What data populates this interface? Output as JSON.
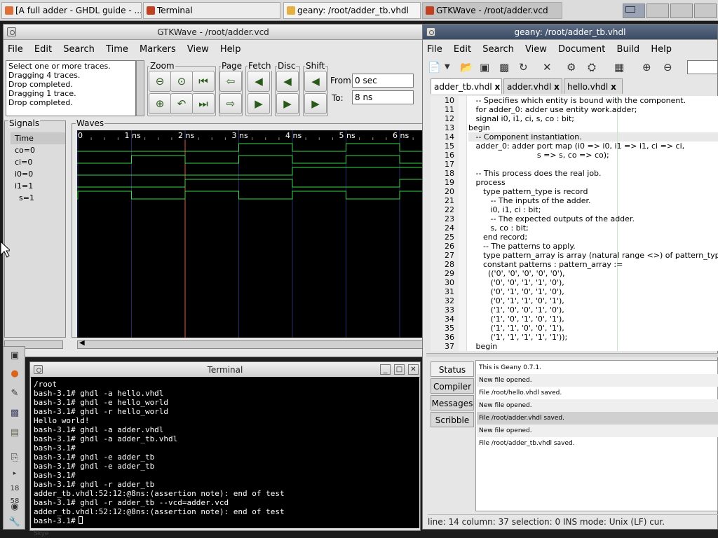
{
  "taskbar": {
    "items": [
      {
        "label": "[A full adder - GHDL guide - ..."
      },
      {
        "label": "Terminal"
      },
      {
        "label": "geany: /root/adder_tb.vhdl"
      },
      {
        "label": "GTKWave - /root/adder.vcd"
      }
    ]
  },
  "gtkwave": {
    "title": "GTKWave - /root/adder.vcd",
    "menu": [
      "File",
      "Edit",
      "Search",
      "Time",
      "Markers",
      "View",
      "Help"
    ],
    "messages": "Select one or more traces.\nDragging 4 traces.\nDrop completed.\nDragging 1 trace.\nDrop completed.",
    "groups": {
      "zoom": "Zoom",
      "page": "Page",
      "fetch": "Fetch",
      "disc": "Disc",
      "shift": "Shift"
    },
    "from_label": "From:",
    "from_value": "0 sec",
    "to_label": "To:",
    "to_value": "8 ns",
    "signals_label": "Signals",
    "waves_label": "Waves",
    "signal_header": "Time",
    "signals": [
      "co=0",
      "ci=0",
      "i0=0",
      "i1=1",
      "s=1"
    ],
    "time_ticks": [
      "0",
      "1 ns",
      "2 ns",
      "3 ns",
      "4 ns",
      "5 ns",
      "6 ns"
    ],
    "wave_color": "#39d84a",
    "marker_color": "#e05a3a",
    "waves_ns": {
      "co": [
        [
          3,
          4
        ],
        [
          5,
          6
        ]
      ],
      "ci": [
        [
          1,
          2
        ],
        [
          3,
          4
        ],
        [
          5,
          6
        ]
      ],
      "i0": [
        [
          4,
          8
        ]
      ],
      "i1": [
        [
          2,
          4
        ],
        [
          6,
          8
        ]
      ],
      "s": [
        [
          0,
          1
        ],
        [
          2,
          3
        ],
        [
          4,
          5
        ],
        [
          6,
          7
        ]
      ]
    },
    "marker_ns": 2
  },
  "geany": {
    "title": "geany: /root/adder_tb.vhdl",
    "menu": [
      "File",
      "Edit",
      "Search",
      "View",
      "Document",
      "Build",
      "Help"
    ],
    "tabs": [
      "adder_tb.vhdl",
      "adder.vhdl",
      "hello.vhdl"
    ],
    "tab_close": "x",
    "lines": [
      {
        "n": "10",
        "t": "   -- Specifies which entity is bound with the component."
      },
      {
        "n": "11",
        "t": "   for adder_0: adder use entity work.adder;"
      },
      {
        "n": "12",
        "t": "   signal i0, i1, ci, s, co : bit;"
      },
      {
        "n": "13",
        "t": "begin"
      },
      {
        "n": "14",
        "t": "   -- Component instantiation."
      },
      {
        "n": "15",
        "t": "   adder_0: adder port map (i0 => i0, i1 => i1, ci => ci,"
      },
      {
        "n": "16",
        "t": "                            s => s, co => co);"
      },
      {
        "n": "17",
        "t": ""
      },
      {
        "n": "18",
        "t": "   -- This process does the real job."
      },
      {
        "n": "19",
        "t": "   process"
      },
      {
        "n": "20",
        "t": "      type pattern_type is record"
      },
      {
        "n": "21",
        "t": "         -- The inputs of the adder."
      },
      {
        "n": "22",
        "t": "         i0, i1, ci : bit;"
      },
      {
        "n": "23",
        "t": "         -- The expected outputs of the adder."
      },
      {
        "n": "24",
        "t": "         s, co : bit;"
      },
      {
        "n": "25",
        "t": "      end record;"
      },
      {
        "n": "26",
        "t": "      -- The patterns to apply."
      },
      {
        "n": "27",
        "t": "      type pattern_array is array (natural range <>) of pattern_typ"
      },
      {
        "n": "28",
        "t": "      constant patterns : pattern_array :="
      },
      {
        "n": "29",
        "t": "        (('0', '0', '0', '0', '0'),"
      },
      {
        "n": "30",
        "t": "         ('0', '0', '1', '1', '0'),"
      },
      {
        "n": "31",
        "t": "         ('0', '1', '0', '1', '0'),"
      },
      {
        "n": "32",
        "t": "         ('0', '1', '1', '0', '1'),"
      },
      {
        "n": "33",
        "t": "         ('1', '0', '0', '1', '0'),"
      },
      {
        "n": "34",
        "t": "         ('1', '0', '1', '0', '1'),"
      },
      {
        "n": "35",
        "t": "         ('1', '1', '0', '0', '1'),"
      },
      {
        "n": "36",
        "t": "         ('1', '1', '1', '1', '1'));"
      },
      {
        "n": "37",
        "t": "   begin"
      }
    ],
    "msg_tabs": [
      "Status",
      "Compiler",
      "Messages",
      "Scribble"
    ],
    "messages": [
      "This is Geany 0.7.1.",
      "New file opened.",
      "File /root/hello.vhdl saved.",
      "New file opened.",
      "File /root/adder.vhdl saved.",
      "New file opened.",
      "File /root/adder_tb.vhdl saved."
    ],
    "statusbar": "line:  14 column:  37  selection:   0  INS    mode: Unix (LF)    cur."
  },
  "terminal": {
    "title": "Terminal",
    "lines": [
      "/root",
      "bash-3.1# ghdl -a hello.vhdl",
      "bash-3.1# ghdl -e hello_world",
      "bash-3.1# ghdl -r hello_world",
      "Hello world!",
      "bash-3.1# ghdl -a adder.vhdl",
      "bash-3.1# ghdl -a adder_tb.vhdl",
      "bash-3.1#",
      "bash-3.1# ghdl -e adder_tb",
      "bash-3.1# ghdl -e adder_tb",
      "bash-3.1#",
      "bash-3.1# ghdl -r adder_tb",
      "adder_tb.vhdl:52:12:@8ns:(assertion note): end of test",
      "bash-3.1# ghdl -r adder_tb --vcd=adder.vcd",
      "adder_tb.vhdl:52:12:@8ns:(assertion note): end of test",
      "bash-3.1# "
    ]
  },
  "dock": {
    "clock": "18 58",
    "bottom_text": "Skye"
  }
}
